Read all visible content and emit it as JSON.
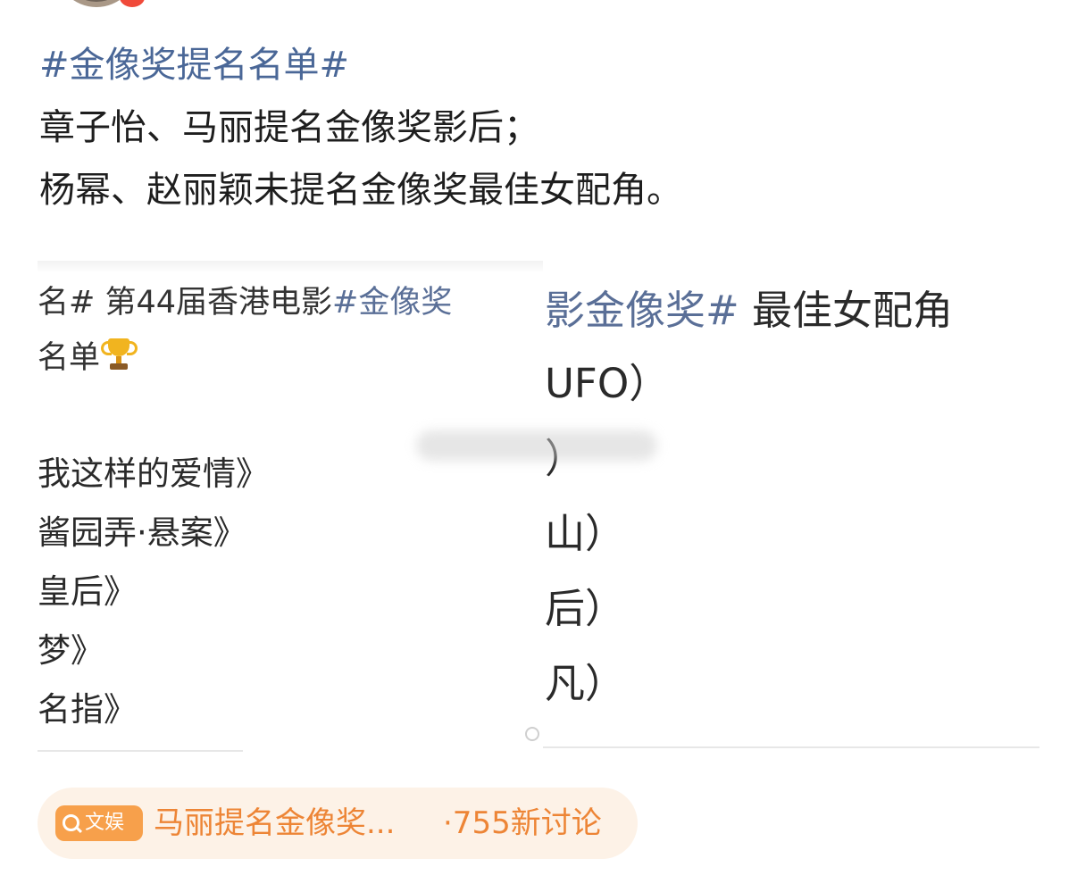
{
  "post": {
    "hashtag": "#金像奖提名名单#",
    "lines": [
      "章子怡、马丽提名金像奖影后；",
      "杨幂、赵丽颖未提名金像奖最佳女配角。"
    ]
  },
  "left_image": {
    "header_prefix": "名#",
    "header_text": " 第44届香港电影",
    "header_tag": "#金像奖",
    "subheader": "名单",
    "films": [
      "我这样的爱情》",
      "酱园弄·悬案》",
      "皇后》",
      "梦》",
      "名指》"
    ]
  },
  "right_image": {
    "header_tag": "影金像奖#",
    "header_text": " 最佳女配角",
    "nominees": [
      "UFO）",
      "）",
      "山）",
      "后）",
      "凡）"
    ]
  },
  "topic": {
    "badge": "文娱",
    "title": "马丽提名金像奖...",
    "count": "·755新讨论"
  },
  "colors": {
    "hashtag_blue": "#4a6797",
    "topic_orange": "#ed8536",
    "topic_badge_bg": "#f7a04b",
    "topic_pill_bg": "#fdf2e7"
  }
}
